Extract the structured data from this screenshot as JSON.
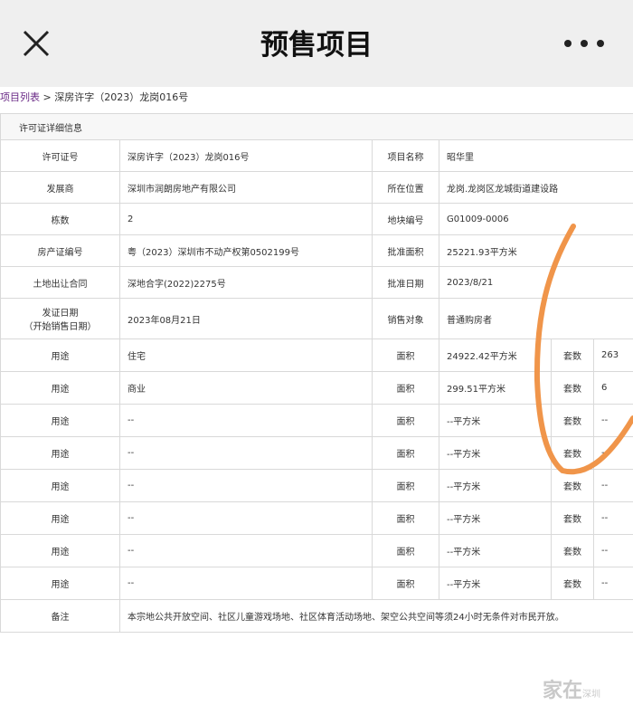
{
  "nav": {
    "title": "预售项目",
    "close_icon": "close-icon",
    "more_icon": "more-icon"
  },
  "breadcrumb": {
    "link": "项目列表",
    "separator": ">",
    "current": "深房许字（2023）龙岗016号"
  },
  "section_title": "许可证详细信息",
  "info_rows": [
    {
      "l1": "许可证号",
      "v1": "深房许字（2023）龙岗016号",
      "l2": "项目名称",
      "v2": "昭华里"
    },
    {
      "l1": "发展商",
      "v1": "深圳市润朗房地产有限公司",
      "l2": "所在位置",
      "v2": "龙岗.龙岗区龙城街道建设路"
    },
    {
      "l1": "栋数",
      "v1": "2",
      "l2": "地块编号",
      "v2": "G01009-0006"
    },
    {
      "l1": "房产证编号",
      "v1": "粤（2023）深圳市不动产权第0502199号",
      "l2": "批准面积",
      "v2": "25221.93平方米"
    },
    {
      "l1": "土地出让合同",
      "v1": "深地合字(2022)2275号",
      "l2": "批准日期",
      "v2": "2023/8/21"
    }
  ],
  "issue_row": {
    "l1a": "发证日期",
    "l1b": "（开始销售日期）",
    "v1": "2023年08月21日",
    "l2": "销售对象",
    "v2": "普通购房者"
  },
  "usage_rows": [
    {
      "label": "用途",
      "use": "住宅",
      "area_label": "面积",
      "area": "24922.42平方米",
      "units_label": "套数",
      "units": "263"
    },
    {
      "label": "用途",
      "use": "商业",
      "area_label": "面积",
      "area": "299.51平方米",
      "units_label": "套数",
      "units": "6"
    },
    {
      "label": "用途",
      "use": "--",
      "area_label": "面积",
      "area": "--平方米",
      "units_label": "套数",
      "units": "--"
    },
    {
      "label": "用途",
      "use": "--",
      "area_label": "面积",
      "area": "--平方米",
      "units_label": "套数",
      "units": "--"
    },
    {
      "label": "用途",
      "use": "--",
      "area_label": "面积",
      "area": "--平方米",
      "units_label": "套数",
      "units": "--"
    },
    {
      "label": "用途",
      "use": "--",
      "area_label": "面积",
      "area": "--平方米",
      "units_label": "套数",
      "units": "--"
    },
    {
      "label": "用途",
      "use": "--",
      "area_label": "面积",
      "area": "--平方米",
      "units_label": "套数",
      "units": "--"
    },
    {
      "label": "用途",
      "use": "--",
      "area_label": "面积",
      "area": "--平方米",
      "units_label": "套数",
      "units": "--"
    }
  ],
  "remark": {
    "label": "备注",
    "text": "本宗地公共开放空间、社区儿童游戏场地、社区体育活动场地、架空公共空间等须24小时无条件对市民开放。"
  },
  "watermark": {
    "main": "家在",
    "sub": "深圳"
  },
  "annotation_color": "#f0954a"
}
